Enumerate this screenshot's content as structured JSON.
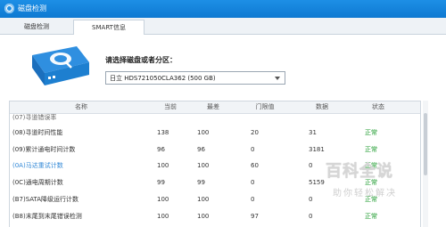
{
  "window": {
    "title": "磁盘检测"
  },
  "tabs": [
    {
      "label": "磁盘检测"
    },
    {
      "label": "SMART信息"
    }
  ],
  "selector": {
    "label": "请选择磁盘或者分区：",
    "selected": "日立  HDS721050CLA362  (500 GB)"
  },
  "table": {
    "headers": [
      "名称",
      "当前",
      "最差",
      "门限值",
      "数据",
      "状态"
    ],
    "partial_top": "(07)寻道错误率",
    "rows": [
      {
        "name": "(08)寻道时间性能",
        "current": "138",
        "worst": "100",
        "threshold": "20",
        "data": "31",
        "status": "正常"
      },
      {
        "name": "(09)累计通电时间计数",
        "current": "96",
        "worst": "96",
        "threshold": "0",
        "data": "3181",
        "status": "正常"
      },
      {
        "name": "(0A)马达重试计数",
        "current": "100",
        "worst": "100",
        "threshold": "60",
        "data": "0",
        "status": "正常"
      },
      {
        "name": "(0C)通电周期计数",
        "current": "99",
        "worst": "99",
        "threshold": "0",
        "data": "5159",
        "status": "正常"
      },
      {
        "name": "(B7)SATA降级运行计数",
        "current": "100",
        "worst": "100",
        "threshold": "0",
        "data": "0",
        "status": "正常"
      },
      {
        "name": "(B8)末尾到末尾错误检测",
        "current": "100",
        "worst": "100",
        "threshold": "97",
        "data": "0",
        "status": "正常"
      }
    ]
  },
  "watermark": {
    "main": "百科全说",
    "sub": "助你轻松解决"
  },
  "colors": {
    "titlebar": "#1d8fe6",
    "status_ok": "#1d9b2e",
    "link": "#2f87d6"
  }
}
